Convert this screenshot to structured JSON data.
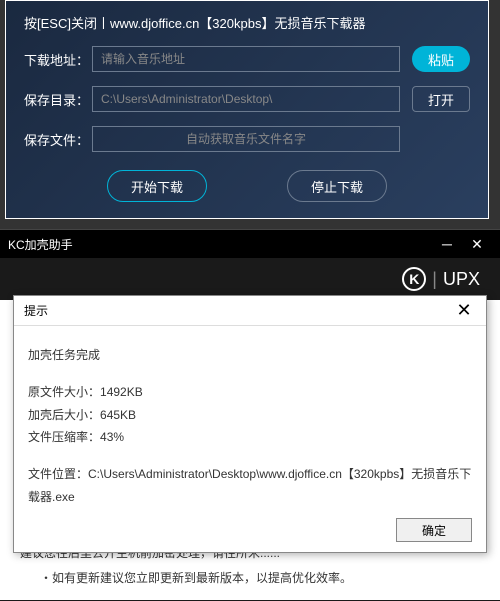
{
  "downloader": {
    "title": "按[ESC]关闭丨www.djoffice.cn【320kpbs】无损音乐下载器",
    "url_label": "下载地址：",
    "url_placeholder": "请输入音乐地址",
    "paste_label": "粘贴",
    "dir_label": "保存目录：",
    "dir_value": "C:\\Users\\Administrator\\Desktop\\",
    "open_label": "打开",
    "file_label": "保存文件：",
    "file_placeholder": "自动获取音乐文件名字",
    "start_label": "开始下载",
    "stop_label": "停止下载"
  },
  "kc": {
    "title": "KC加壳助手",
    "brand": "UPX",
    "footer_line1": "建议您往后里去开主机前加密处理，请往所米......",
    "footer_line2": "・如有更新建议您立即更新到最新版本，以提高优化效率。"
  },
  "dialog": {
    "title": "提示",
    "task_done": "加壳任务完成",
    "orig_size_label": "原文件大小：",
    "orig_size_value": "1492KB",
    "packed_size_label": "加壳后大小：",
    "packed_size_value": "645KB",
    "ratio_label": "文件压缩率：",
    "ratio_value": "43%",
    "path_label": "文件位置：",
    "path_value": "C:\\Users\\Administrator\\Desktop\\www.djoffice.cn【320kpbs】无损音乐下载器.exe",
    "ok_label": "确定"
  }
}
